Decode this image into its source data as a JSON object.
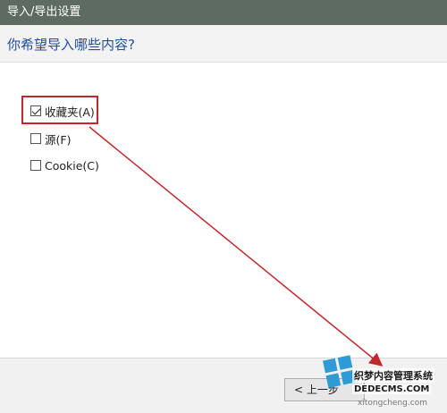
{
  "window": {
    "title": "导入/导出设置"
  },
  "header": {
    "question": "你希望导入哪些内容?"
  },
  "options": [
    {
      "label": "收藏夹(A)",
      "checked": true
    },
    {
      "label": "源(F)",
      "checked": false
    },
    {
      "label": "Cookie(C)",
      "checked": false
    }
  ],
  "footer": {
    "back_label": "< 上一步"
  },
  "annotation": {
    "color": "#c0282d"
  },
  "watermark": {
    "text": "织梦内容管理系统",
    "url": "DEDECMS.COM",
    "domain": "xitongcheng.com"
  }
}
